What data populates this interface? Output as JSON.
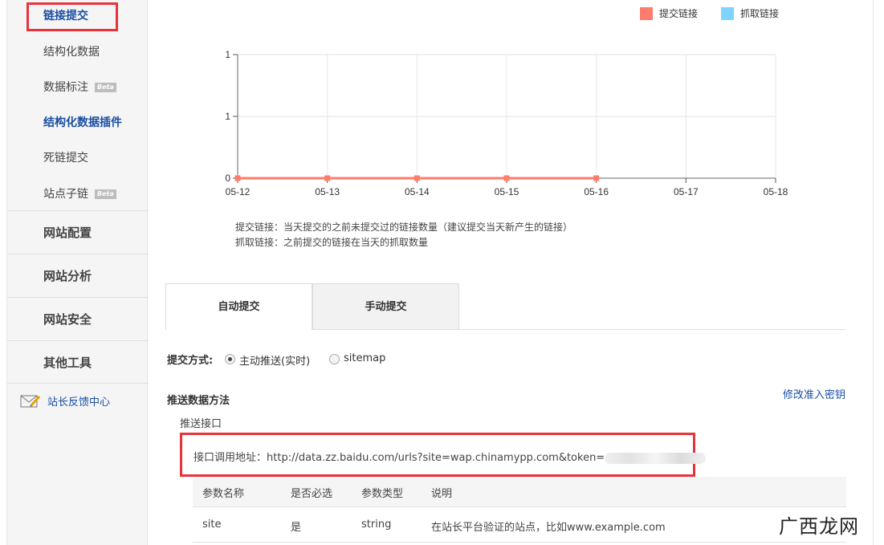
{
  "sidebar": {
    "sub_items": [
      {
        "label": "链接提交",
        "active": true
      },
      {
        "label": "结构化数据",
        "active": false
      },
      {
        "label": "数据标注",
        "badge": "Beta"
      },
      {
        "label": "结构化数据插件",
        "active": true
      },
      {
        "label": "死链提交",
        "active": false
      },
      {
        "label": "站点子链",
        "badge": "Beta"
      }
    ],
    "groups": [
      "网站配置",
      "网站分析",
      "网站安全",
      "其他工具"
    ],
    "feedback": "站长反馈中心"
  },
  "legend": {
    "submit": {
      "label": "提交链接",
      "color": "#ff7b6b"
    },
    "crawl": {
      "label": "抓取链接",
      "color": "#7fd3ff"
    }
  },
  "chart_data": {
    "type": "line",
    "x": [
      "05-12",
      "05-13",
      "05-14",
      "05-15",
      "05-16",
      "05-17",
      "05-18"
    ],
    "y_tick_labels": [
      "0",
      "1",
      "1"
    ],
    "series": [
      {
        "name": "提交链接",
        "color": "#ff7b6b",
        "values": [
          0,
          0,
          0,
          0,
          0
        ]
      }
    ]
  },
  "notes": {
    "submit": "提交链接：当天提交的之前未提交过的链接数量（建议提交当天新产生的链接）",
    "crawl": "抓取链接：之前提交的链接在当天的抓取数量"
  },
  "tabs": {
    "auto": "自动提交",
    "manual": "手动提交"
  },
  "form": {
    "method_label": "提交方式:",
    "option_active": "主动推送(实时)",
    "option_sitemap": "sitemap",
    "push_heading": "推送数据方法",
    "modify_key": "修改准入密钥",
    "push_api": "推送接口",
    "api_prefix": "接口调用地址：",
    "api_url": "http://data.zz.baidu.com/urls?site=wap.chinamypp.com&token="
  },
  "table": {
    "headers": [
      "参数名称",
      "是否必选",
      "参数类型",
      "说明"
    ],
    "rows": [
      [
        "site",
        "是",
        "string",
        "在站长平台验证的站点，比如www.example.com"
      ]
    ]
  },
  "watermark": "广西龙网"
}
